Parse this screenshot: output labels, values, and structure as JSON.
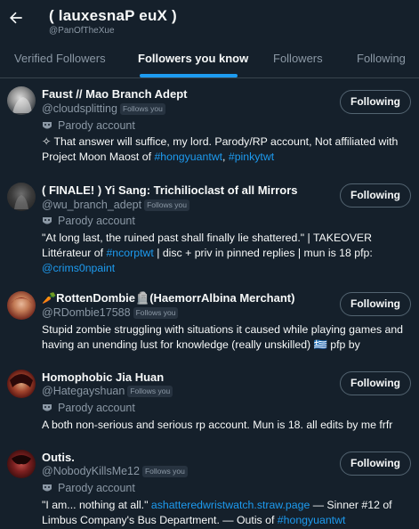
{
  "header": {
    "back_icon": "arrow-left-icon",
    "title": "( lauxesnaP euX )",
    "handle": "@PanOfTheXue"
  },
  "tabs": [
    {
      "label": "Verified Followers",
      "active": false
    },
    {
      "label": "Followers you know",
      "active": true
    },
    {
      "label": "Followers",
      "active": false
    },
    {
      "label": "Following",
      "active": false
    }
  ],
  "colors": {
    "background": "#15202b",
    "accent": "#1d9bf0",
    "muted": "#8b98a5"
  },
  "users": [
    {
      "name": "Faust // Mao Branch Adept",
      "handle": "@cloudsplitting",
      "follows_you": "Follows you",
      "parody": "Parody account",
      "bio": {
        "line1_a": "✧ That answer will suffice, my lord. Parody/RP account, Not affiliated with",
        "line2_a": "Project Moon Maost of ",
        "line2_link1": "#hongyuantwt",
        "line2_b": ", ",
        "line2_link2": "#pinkytwt"
      },
      "button": "Following"
    },
    {
      "name": "( FINALE! ) Yi Sang: Trichilioclast of all Mirrors",
      "handle": "@wu_branch_adept",
      "follows_you": "Follows you",
      "parody": "Parody account",
      "bio": {
        "line1_a": "\"At long last, the ruined past shall finally lie shattered.\" | TAKEOVER",
        "line2_a": "Littérateur of ",
        "line2_link1": "#ncorptwt",
        "line2_b": " | disc + priv in pinned replies | mun is 18 pfp:",
        "line3_link1": "@crims0npaint"
      },
      "button": "Following"
    },
    {
      "name": "🥕RottenDombie🪦(HaemorrAlbina Merchant)",
      "handle": "@RDombie17588",
      "follows_you": "Follows you",
      "bio": {
        "line1_a": "Stupid zombie struggling with situations it caused while playing games and",
        "line2_a": "having an unending lust for knowledge (really unskilled) 🇬🇷 pfp by"
      },
      "button": "Following"
    },
    {
      "name": "Homophobic Jia Huan",
      "handle": "@Hategayshuan",
      "follows_you": "Follows you",
      "parody": "Parody account",
      "bio": {
        "line1_a": "A both non-serious and serious rp account. Mun is 18. all edits by me frfr"
      },
      "button": "Following"
    },
    {
      "name": "Outis.",
      "handle": "@NobodyKillsMe12",
      "follows_you": "Follows you",
      "parody": "Parody account",
      "bio": {
        "line1_a": "\"I am... nothing at all.\" ",
        "line1_link1": "ashatteredwristwatch.straw.page",
        "line1_b": " — Sinner #12 of",
        "line2_a": "Limbus Company's Bus Department. — Outis of ",
        "line2_link1": "#hongyuantwt"
      },
      "button": "Following"
    }
  ]
}
